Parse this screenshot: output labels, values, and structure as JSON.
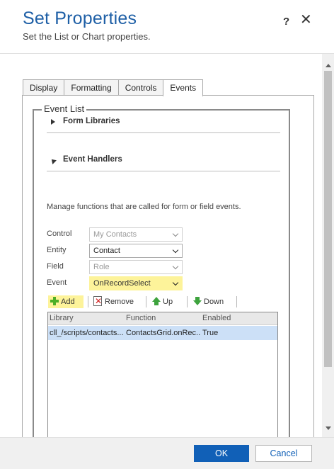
{
  "header": {
    "title": "Set Properties",
    "subtitle": "Set the List or Chart properties.",
    "help_label": "?",
    "close_label": "✕"
  },
  "tabs": [
    {
      "label": "Display",
      "active": false
    },
    {
      "label": "Formatting",
      "active": false
    },
    {
      "label": "Controls",
      "active": false
    },
    {
      "label": "Events",
      "active": true
    }
  ],
  "event_list": {
    "legend": "Event List",
    "sections": {
      "form_libraries": {
        "label": "Form Libraries",
        "expanded": false
      },
      "event_handlers": {
        "label": "Event Handlers",
        "expanded": true
      }
    },
    "description": "Manage functions that are called for form or field events.",
    "fields": {
      "control": {
        "label": "Control",
        "value": "My Contacts",
        "disabled": true
      },
      "entity": {
        "label": "Entity",
        "value": "Contact",
        "disabled": false
      },
      "field": {
        "label": "Field",
        "value": "Role",
        "disabled": true
      },
      "event": {
        "label": "Event",
        "value": "OnRecordSelect",
        "highlighted": true
      }
    },
    "toolbar": {
      "add_label": "Add",
      "remove_label": "Remove",
      "up_label": "Up",
      "down_label": "Down"
    },
    "grid": {
      "columns": [
        "Library",
        "Function",
        "Enabled"
      ],
      "rows": [
        {
          "library": "cll_/scripts/contacts...",
          "function": "ContactsGrid.onRec...",
          "enabled": "True",
          "selected": true
        }
      ]
    }
  },
  "footer": {
    "ok_label": "OK",
    "cancel_label": "Cancel"
  },
  "colors": {
    "title": "#1e5fa6",
    "primary_button": "#1160b7",
    "highlight": "#fdf39a",
    "selected_row": "#cce0f7"
  }
}
